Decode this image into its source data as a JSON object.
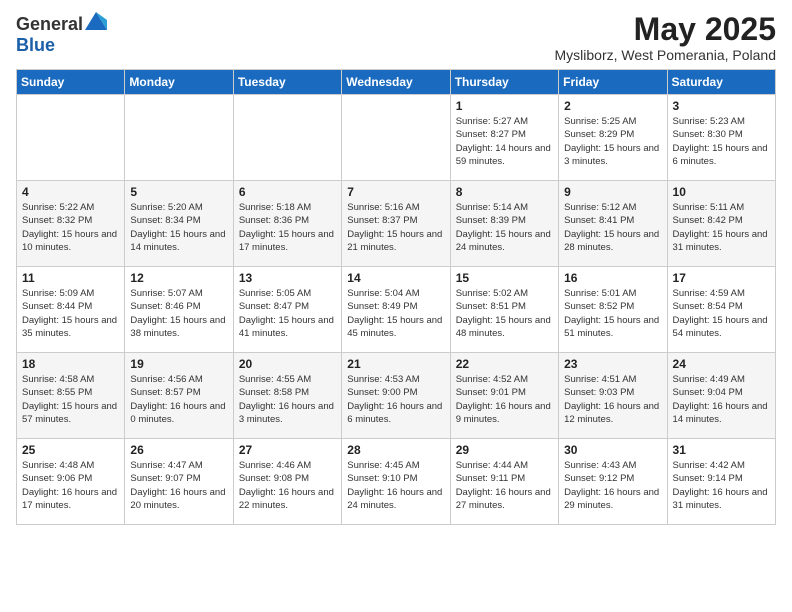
{
  "header": {
    "logo_general": "General",
    "logo_blue": "Blue",
    "title": "May 2025",
    "location": "Mysliborz, West Pomerania, Poland"
  },
  "days_of_week": [
    "Sunday",
    "Monday",
    "Tuesday",
    "Wednesday",
    "Thursday",
    "Friday",
    "Saturday"
  ],
  "weeks": [
    [
      {
        "day": "",
        "info": ""
      },
      {
        "day": "",
        "info": ""
      },
      {
        "day": "",
        "info": ""
      },
      {
        "day": "",
        "info": ""
      },
      {
        "day": "1",
        "info": "Sunrise: 5:27 AM\nSunset: 8:27 PM\nDaylight: 14 hours and 59 minutes."
      },
      {
        "day": "2",
        "info": "Sunrise: 5:25 AM\nSunset: 8:29 PM\nDaylight: 15 hours and 3 minutes."
      },
      {
        "day": "3",
        "info": "Sunrise: 5:23 AM\nSunset: 8:30 PM\nDaylight: 15 hours and 6 minutes."
      }
    ],
    [
      {
        "day": "4",
        "info": "Sunrise: 5:22 AM\nSunset: 8:32 PM\nDaylight: 15 hours and 10 minutes."
      },
      {
        "day": "5",
        "info": "Sunrise: 5:20 AM\nSunset: 8:34 PM\nDaylight: 15 hours and 14 minutes."
      },
      {
        "day": "6",
        "info": "Sunrise: 5:18 AM\nSunset: 8:36 PM\nDaylight: 15 hours and 17 minutes."
      },
      {
        "day": "7",
        "info": "Sunrise: 5:16 AM\nSunset: 8:37 PM\nDaylight: 15 hours and 21 minutes."
      },
      {
        "day": "8",
        "info": "Sunrise: 5:14 AM\nSunset: 8:39 PM\nDaylight: 15 hours and 24 minutes."
      },
      {
        "day": "9",
        "info": "Sunrise: 5:12 AM\nSunset: 8:41 PM\nDaylight: 15 hours and 28 minutes."
      },
      {
        "day": "10",
        "info": "Sunrise: 5:11 AM\nSunset: 8:42 PM\nDaylight: 15 hours and 31 minutes."
      }
    ],
    [
      {
        "day": "11",
        "info": "Sunrise: 5:09 AM\nSunset: 8:44 PM\nDaylight: 15 hours and 35 minutes."
      },
      {
        "day": "12",
        "info": "Sunrise: 5:07 AM\nSunset: 8:46 PM\nDaylight: 15 hours and 38 minutes."
      },
      {
        "day": "13",
        "info": "Sunrise: 5:05 AM\nSunset: 8:47 PM\nDaylight: 15 hours and 41 minutes."
      },
      {
        "day": "14",
        "info": "Sunrise: 5:04 AM\nSunset: 8:49 PM\nDaylight: 15 hours and 45 minutes."
      },
      {
        "day": "15",
        "info": "Sunrise: 5:02 AM\nSunset: 8:51 PM\nDaylight: 15 hours and 48 minutes."
      },
      {
        "day": "16",
        "info": "Sunrise: 5:01 AM\nSunset: 8:52 PM\nDaylight: 15 hours and 51 minutes."
      },
      {
        "day": "17",
        "info": "Sunrise: 4:59 AM\nSunset: 8:54 PM\nDaylight: 15 hours and 54 minutes."
      }
    ],
    [
      {
        "day": "18",
        "info": "Sunrise: 4:58 AM\nSunset: 8:55 PM\nDaylight: 15 hours and 57 minutes."
      },
      {
        "day": "19",
        "info": "Sunrise: 4:56 AM\nSunset: 8:57 PM\nDaylight: 16 hours and 0 minutes."
      },
      {
        "day": "20",
        "info": "Sunrise: 4:55 AM\nSunset: 8:58 PM\nDaylight: 16 hours and 3 minutes."
      },
      {
        "day": "21",
        "info": "Sunrise: 4:53 AM\nSunset: 9:00 PM\nDaylight: 16 hours and 6 minutes."
      },
      {
        "day": "22",
        "info": "Sunrise: 4:52 AM\nSunset: 9:01 PM\nDaylight: 16 hours and 9 minutes."
      },
      {
        "day": "23",
        "info": "Sunrise: 4:51 AM\nSunset: 9:03 PM\nDaylight: 16 hours and 12 minutes."
      },
      {
        "day": "24",
        "info": "Sunrise: 4:49 AM\nSunset: 9:04 PM\nDaylight: 16 hours and 14 minutes."
      }
    ],
    [
      {
        "day": "25",
        "info": "Sunrise: 4:48 AM\nSunset: 9:06 PM\nDaylight: 16 hours and 17 minutes."
      },
      {
        "day": "26",
        "info": "Sunrise: 4:47 AM\nSunset: 9:07 PM\nDaylight: 16 hours and 20 minutes."
      },
      {
        "day": "27",
        "info": "Sunrise: 4:46 AM\nSunset: 9:08 PM\nDaylight: 16 hours and 22 minutes."
      },
      {
        "day": "28",
        "info": "Sunrise: 4:45 AM\nSunset: 9:10 PM\nDaylight: 16 hours and 24 minutes."
      },
      {
        "day": "29",
        "info": "Sunrise: 4:44 AM\nSunset: 9:11 PM\nDaylight: 16 hours and 27 minutes."
      },
      {
        "day": "30",
        "info": "Sunrise: 4:43 AM\nSunset: 9:12 PM\nDaylight: 16 hours and 29 minutes."
      },
      {
        "day": "31",
        "info": "Sunrise: 4:42 AM\nSunset: 9:14 PM\nDaylight: 16 hours and 31 minutes."
      }
    ]
  ]
}
